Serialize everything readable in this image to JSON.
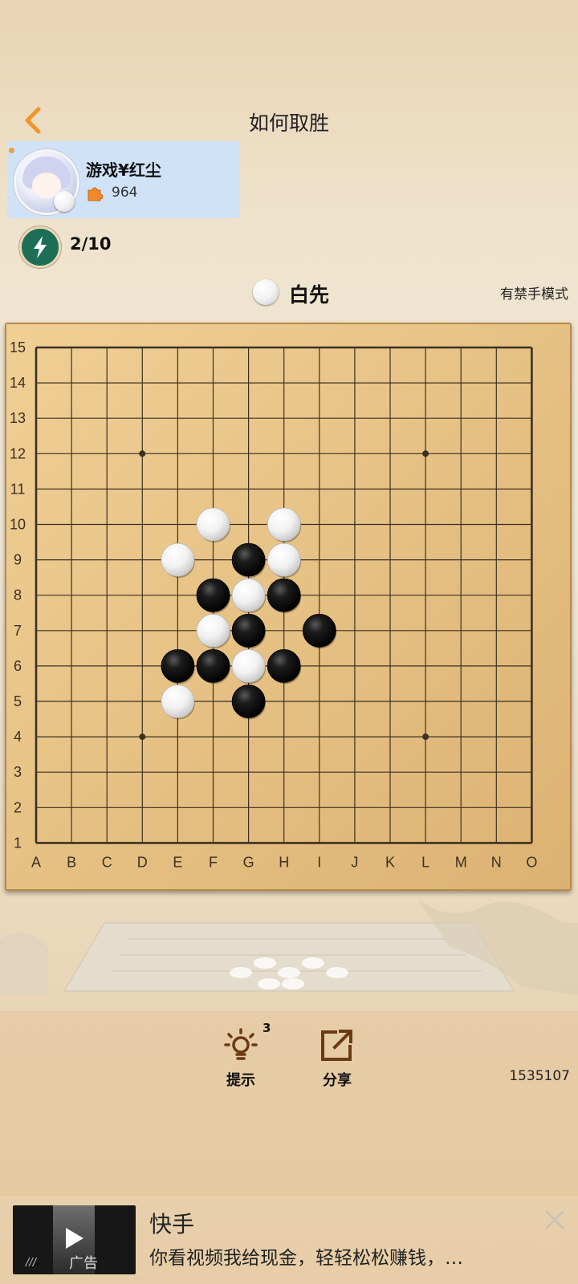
{
  "header": {
    "title": "如何取胜"
  },
  "player": {
    "name": "游戏¥红尘",
    "score": "964"
  },
  "progress": {
    "text": "2/10"
  },
  "turn": {
    "label": "白先",
    "stone": "white"
  },
  "mode": {
    "label": "有禁手模式"
  },
  "board": {
    "size": 15,
    "columns": [
      "A",
      "B",
      "C",
      "D",
      "E",
      "F",
      "G",
      "H",
      "I",
      "J",
      "K",
      "L",
      "M",
      "N",
      "O"
    ],
    "rows": [
      "15",
      "14",
      "13",
      "12",
      "11",
      "10",
      "9",
      "8",
      "7",
      "6",
      "5",
      "4",
      "3",
      "2",
      "1"
    ],
    "star_points": [
      "D12",
      "L12",
      "D4",
      "L4"
    ],
    "stones": {
      "white": [
        "F10",
        "H10",
        "E9",
        "H9",
        "G8",
        "F7",
        "G6",
        "E5"
      ],
      "black": [
        "G9",
        "F8",
        "H8",
        "G7",
        "I7",
        "E6",
        "F6",
        "H6",
        "G5"
      ]
    }
  },
  "tools": {
    "hint": {
      "label": "提示",
      "count": "3",
      "icon": "lightbulb-icon"
    },
    "share": {
      "label": "分享",
      "icon": "share-icon"
    }
  },
  "level_id": "1535107",
  "ad": {
    "title": "快手",
    "description": "你看视频我给现金，轻轻松松赚钱，…",
    "badge": "广告"
  },
  "colors": {
    "accent": "#f0952a",
    "player_card": "#cfe2f6",
    "board": "#e8c58a",
    "progress_icon": "#1e6e55",
    "tool_icon": "#6b3a14"
  }
}
